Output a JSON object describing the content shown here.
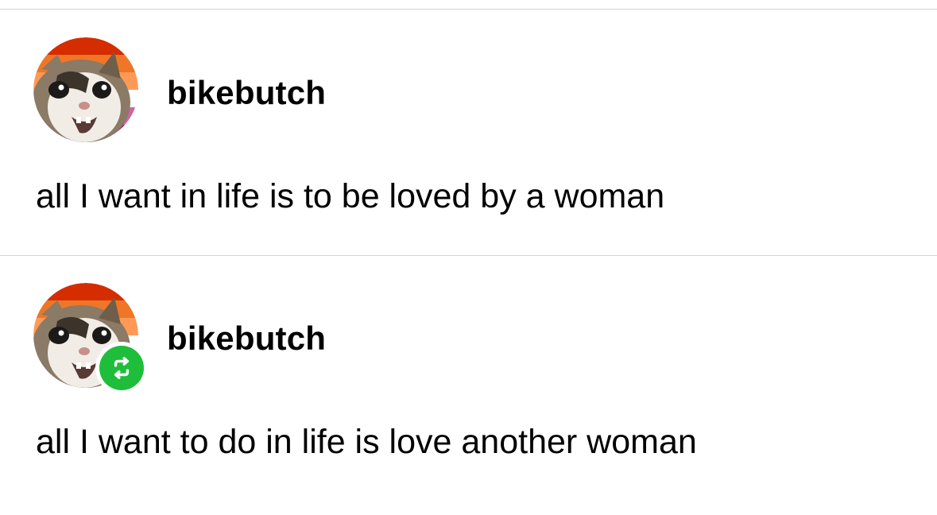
{
  "colors": {
    "divider": "#d4d4d4",
    "text": "#000000",
    "reblog_badge": "#1ebe3a",
    "avatar_flag_stripes": [
      "#d52d00",
      "#ef7627",
      "#ff9a56",
      "#ffffff",
      "#d362a4",
      "#a30262"
    ]
  },
  "posts": [
    {
      "username": "bikebutch",
      "avatar_icon": "cat-avatar",
      "text": "all I want in life is to be loved by a woman",
      "reblogged": false
    },
    {
      "username": "bikebutch",
      "avatar_icon": "cat-avatar",
      "badge_icon": "reblog-icon",
      "text": "all I want to do in life is love another woman",
      "reblogged": true
    }
  ]
}
